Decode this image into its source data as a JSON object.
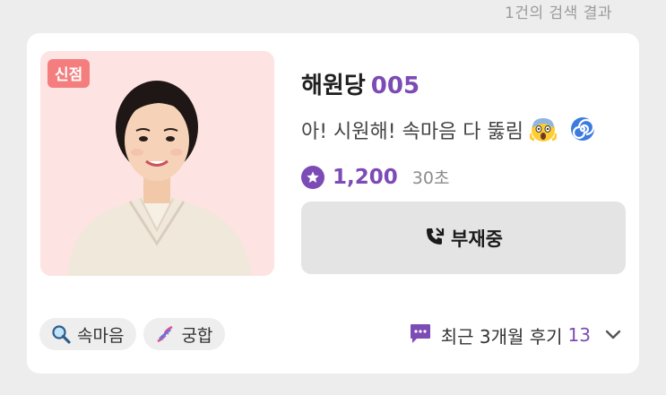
{
  "header": {
    "result_count": "1건의 검색 결과"
  },
  "card": {
    "badge": "신점",
    "name": "해원당",
    "code": "005",
    "tagline": "아! 시원해! 속마음 다 뚫림",
    "rating": "1,200",
    "duration": "30초",
    "status_label": "부재중",
    "tags": [
      {
        "label": "속마음",
        "icon": "magnifier-icon"
      },
      {
        "label": "궁합",
        "icon": "dna-icon"
      }
    ],
    "reviews": {
      "label": "최근 3개월 후기",
      "count": "13"
    }
  },
  "colors": {
    "accent": "#7c4bb5",
    "badge": "#f47d7d",
    "photo_bg": "#fde3e2",
    "card": "#ffffff",
    "page": "#ededed",
    "button": "#e4e4e4"
  }
}
